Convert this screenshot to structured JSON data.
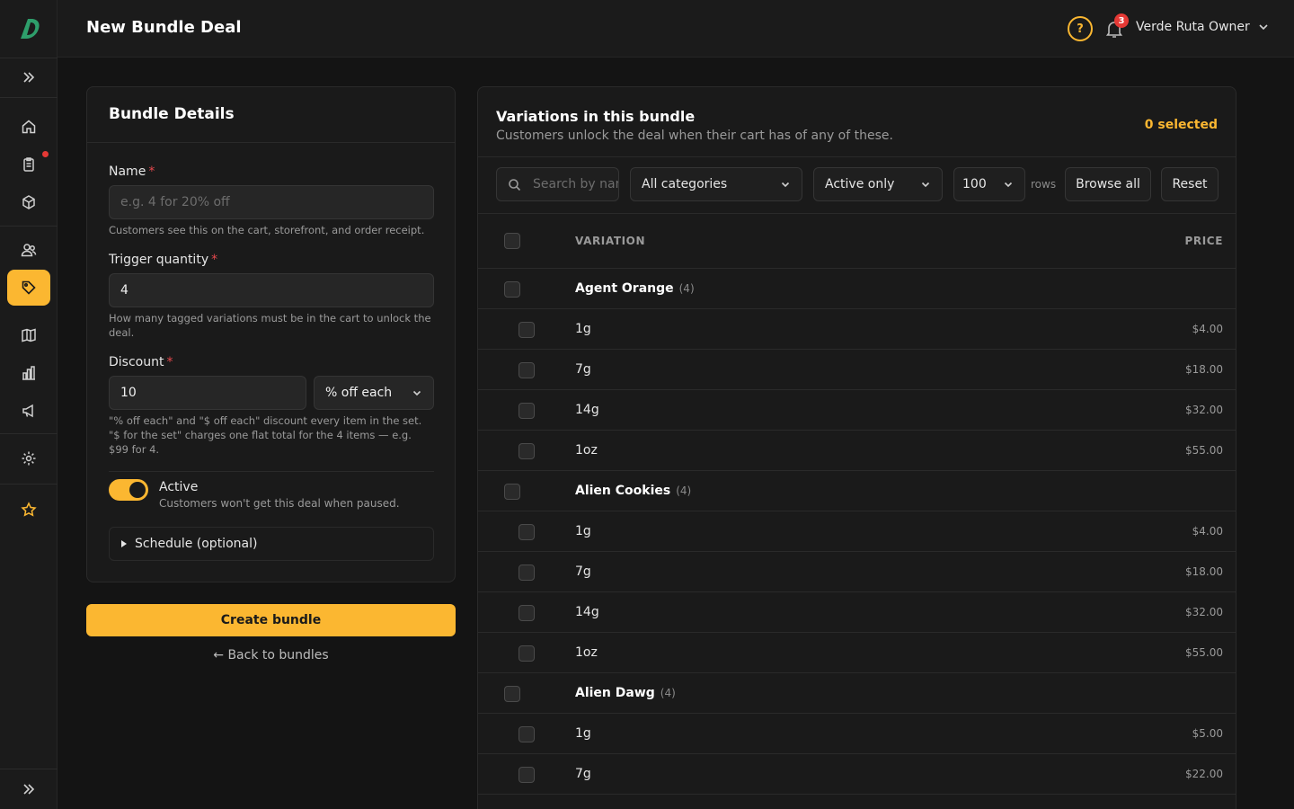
{
  "header": {
    "title": "New Bundle Deal",
    "help_icon": "?",
    "notification_count": "3",
    "user": "Verde Ruta Owner"
  },
  "details": {
    "title": "Bundle Details",
    "name": {
      "label": "Name",
      "required": "*",
      "placeholder": "e.g. 4 for 20% off",
      "help": "Customers see this on the cart, storefront, and order receipt."
    },
    "trigger": {
      "label": "Trigger quantity",
      "required": "*",
      "value": "4",
      "help": "How many tagged variations must be in the cart to unlock the deal."
    },
    "discount": {
      "label": "Discount",
      "required": "*",
      "value": "10",
      "type": "% off each",
      "help": "\"% off each\" and \"$ off each\" discount every item in the set. \"$ for the set\" charges one flat total for the 4 items — e.g. $99 for 4."
    },
    "active": {
      "label": "Active",
      "help": "Customers won't get this deal when paused.",
      "on": true
    },
    "schedule": "Schedule (optional)"
  },
  "actions": {
    "create": "Create bundle",
    "back": "← Back to bundles"
  },
  "variations": {
    "title": "Variations in this bundle",
    "subtitle": "Customers unlock the deal when their cart has of any of these.",
    "selected": "0 selected",
    "search_placeholder": "Search by name",
    "category": "All categories",
    "status": "Active only",
    "rows": "100",
    "rows_label": "rows",
    "browse_all": "Browse all",
    "reset": "Reset",
    "col_variation": "VARIATION",
    "col_price": "PRICE",
    "groups": [
      {
        "name": "Agent Orange",
        "count": "(4)",
        "items": [
          {
            "name": "1g",
            "price": "$4.00"
          },
          {
            "name": "7g",
            "price": "$18.00"
          },
          {
            "name": "14g",
            "price": "$32.00"
          },
          {
            "name": "1oz",
            "price": "$55.00"
          }
        ]
      },
      {
        "name": "Alien Cookies",
        "count": "(4)",
        "items": [
          {
            "name": "1g",
            "price": "$4.00"
          },
          {
            "name": "7g",
            "price": "$18.00"
          },
          {
            "name": "14g",
            "price": "$32.00"
          },
          {
            "name": "1oz",
            "price": "$55.00"
          }
        ]
      },
      {
        "name": "Alien Dawg",
        "count": "(4)",
        "items": [
          {
            "name": "1g",
            "price": "$5.00"
          },
          {
            "name": "7g",
            "price": "$22.00"
          }
        ]
      }
    ]
  },
  "colors": {
    "accent": "#fbb731",
    "danger": "#e5484d",
    "background": "#141414",
    "surface": "#1a1a1a"
  }
}
